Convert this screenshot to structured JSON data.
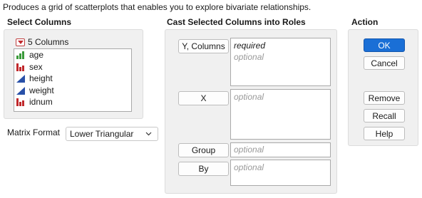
{
  "description": "Produces a grid of scatterplots that enables you to explore bivariate relationships.",
  "select_columns": {
    "title": "Select Columns",
    "count_label": "5 Columns",
    "columns": [
      {
        "name": "age",
        "type_icon": "ordinal-bar-icon",
        "color": "#3a9a3a"
      },
      {
        "name": "sex",
        "type_icon": "nominal-bar-icon",
        "color": "#c0282b"
      },
      {
        "name": "height",
        "type_icon": "continuous-triangle-icon",
        "color": "#2850a8"
      },
      {
        "name": "weight",
        "type_icon": "continuous-triangle-icon",
        "color": "#2850a8"
      },
      {
        "name": "idnum",
        "type_icon": "nominal-bar-icon",
        "color": "#c0282b"
      }
    ]
  },
  "matrix_format": {
    "label": "Matrix Format",
    "selected": "Lower Triangular"
  },
  "roles": {
    "title": "Cast Selected Columns into Roles",
    "y_columns": {
      "label": "Y, Columns",
      "required": "required",
      "optional": "optional"
    },
    "x": {
      "label": "X",
      "optional": "optional"
    },
    "group": {
      "label": "Group",
      "optional": "optional"
    },
    "by": {
      "label": "By",
      "optional": "optional"
    }
  },
  "action": {
    "title": "Action",
    "ok": "OK",
    "cancel": "Cancel",
    "remove": "Remove",
    "recall": "Recall",
    "help": "Help"
  },
  "colors": {
    "accent": "#1a6fd6",
    "panel_bg": "#f0f0f0",
    "nominal": "#c0282b",
    "ordinal": "#3a9a3a",
    "continuous": "#2850a8"
  }
}
